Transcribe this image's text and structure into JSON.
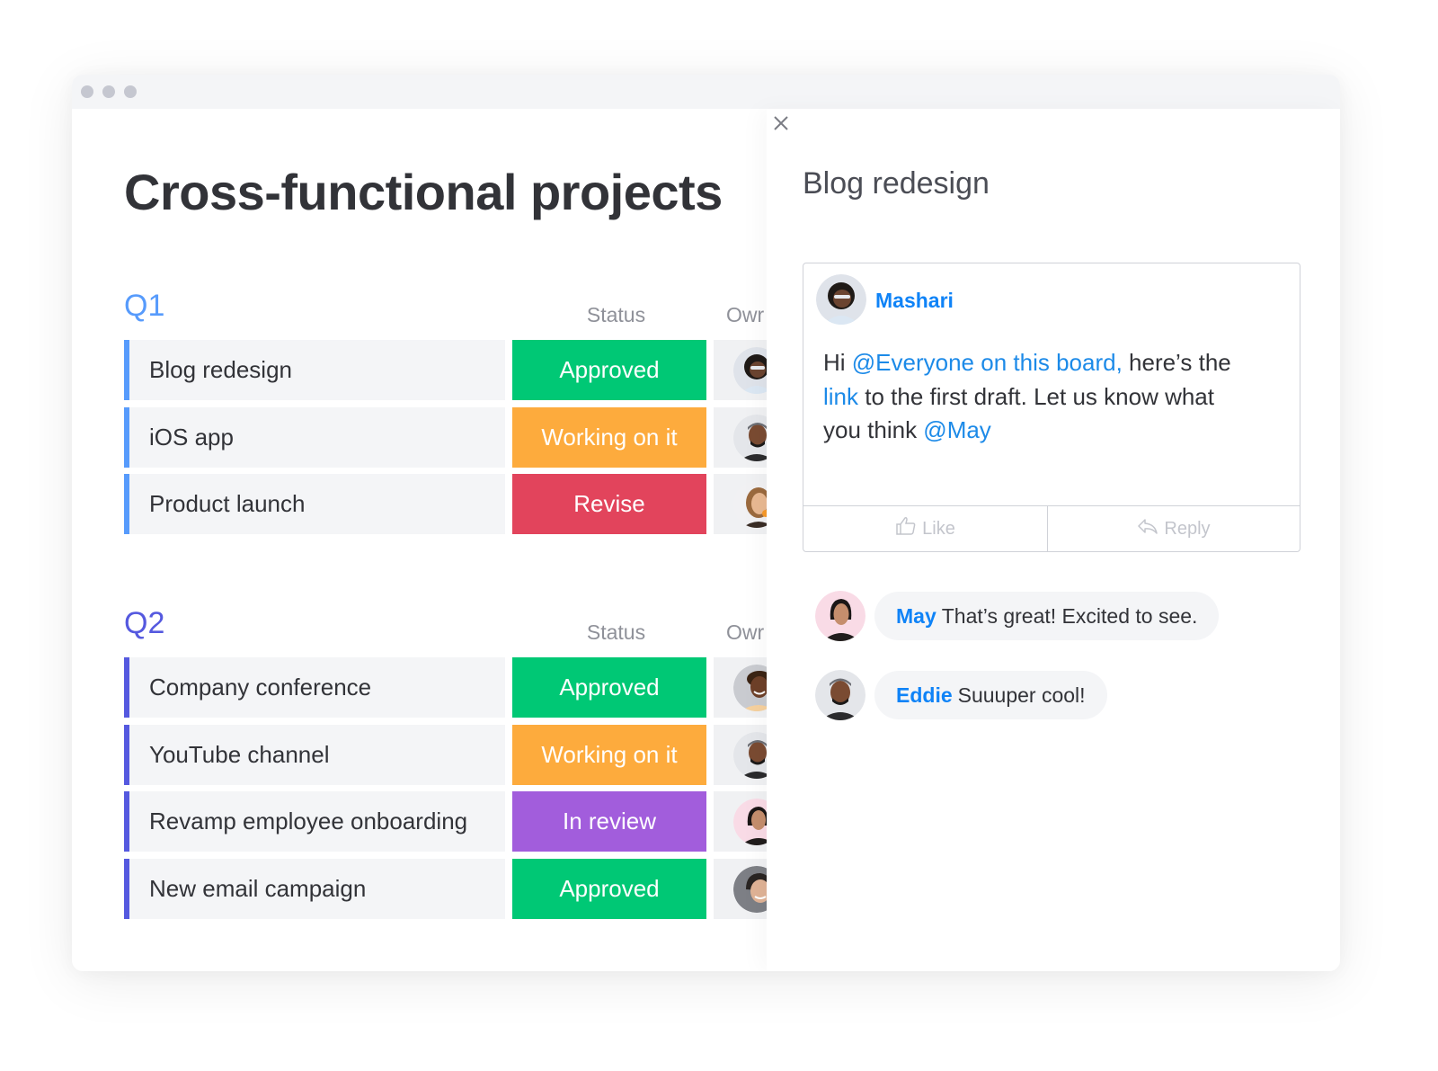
{
  "window": {
    "controls": [
      "window-dot",
      "window-dot",
      "window-dot"
    ]
  },
  "board": {
    "title": "Cross-functional projects",
    "groups": [
      {
        "name": "Q1",
        "color": "#579bfc",
        "columns": {
          "status": "Status",
          "owner": "Owr"
        },
        "items": [
          {
            "name": "Blog redesign",
            "status": "Approved",
            "status_color": "#00c875",
            "owner": "Mashari"
          },
          {
            "name": "iOS app",
            "status": "Working on it",
            "status_color": "#fdab3d",
            "owner": "Eddie"
          },
          {
            "name": "Product launch",
            "status": "Revise",
            "status_color": "#e2445c",
            "owner": "owner-3"
          }
        ]
      },
      {
        "name": "Q2",
        "color": "#5559df",
        "columns": {
          "status": "Status",
          "owner": "Owr"
        },
        "items": [
          {
            "name": "Company conference",
            "status": "Approved",
            "status_color": "#00c875",
            "owner": "owner-4"
          },
          {
            "name": "YouTube channel",
            "status": "Working on it",
            "status_color": "#fdab3d",
            "owner": "Eddie"
          },
          {
            "name": "Revamp employee onboarding",
            "status": "In review",
            "status_color": "#a25ddc",
            "owner": "May"
          },
          {
            "name": "New email campaign",
            "status": "Approved",
            "status_color": "#00c875",
            "owner": "owner-7"
          }
        ]
      }
    ]
  },
  "panel": {
    "close_icon": "close-icon",
    "title": "Blog redesign",
    "post": {
      "author": "Mashari",
      "body": {
        "p1": "Hi ",
        "mention1": "@Everyone on this board,",
        "p2": " here’s the ",
        "link": "link",
        "p3": " to the first draft. Let us know what you think ",
        "mention2": "@May"
      },
      "actions": {
        "like": "Like",
        "like_icon": "thumbs-up-icon",
        "reply": "Reply",
        "reply_icon": "reply-arrow-icon"
      }
    },
    "replies": [
      {
        "author": "May",
        "text": "That’s great! Excited to see."
      },
      {
        "author": "Eddie",
        "text": "Suuuper cool!"
      }
    ]
  }
}
